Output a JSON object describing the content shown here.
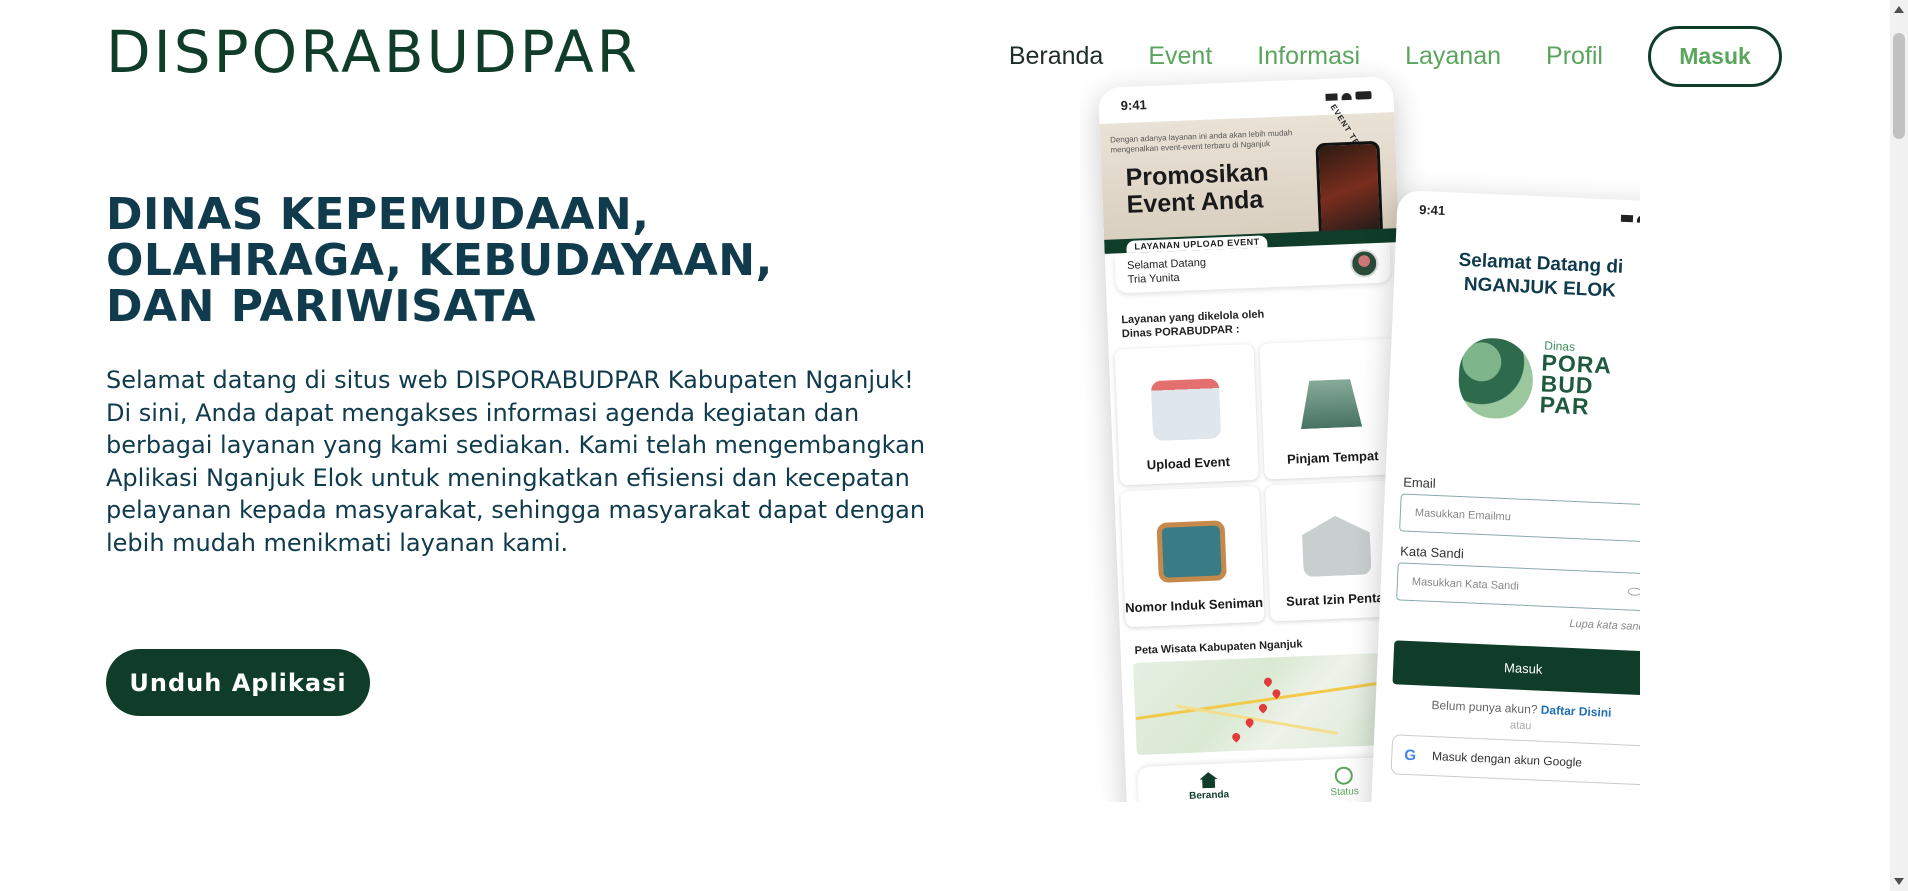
{
  "brand": "DISPORABUDPAR",
  "nav": {
    "items": [
      {
        "label": "Beranda",
        "active": true
      },
      {
        "label": "Event",
        "active": false
      },
      {
        "label": "Informasi",
        "active": false
      },
      {
        "label": "Layanan",
        "active": false
      },
      {
        "label": "Profil",
        "active": false
      }
    ],
    "login_label": "Masuk"
  },
  "hero": {
    "title_lines": [
      "DINAS KEPEMUDAAN,",
      "OLAHRAGA, KEBUDAYAAN,",
      "DAN PARIWISATA"
    ],
    "description": "Selamat datang di situs web DISPORABUDPAR Kabupaten Nganjuk! Di sini, Anda dapat mengakses informasi agenda kegiatan dan berbagai layanan yang kami sediakan. Kami telah mengembangkan Aplikasi Nganjuk Elok untuk meningkatkan efisiensi dan kecepatan pelayanan kepada masyarakat, sehingga masyarakat dapat dengan lebih mudah menikmati layanan kami.",
    "download_label": "Unduh Aplikasi"
  },
  "phone1": {
    "time": "9:41",
    "promo_small": "Dengan adanya layanan ini anda akan lebih mudah mengenalkan event-event terbaru di Nganjuk",
    "promo_title_1": "Promosikan",
    "promo_title_2": "Event Anda",
    "promo_badge": "EVENT TERKINI",
    "promo_label": "LAYANAN UPLOAD EVENT",
    "welcome": "Selamat Datang",
    "user": "Tria Yunita",
    "service_head_1": "Layanan yang dikelola oleh",
    "service_head_2": "Dinas PORABUDPAR :",
    "services": [
      {
        "label": "Upload Event",
        "icon": "calendar-icon"
      },
      {
        "label": "Pinjam Tempat",
        "icon": "building-icon"
      },
      {
        "label": "Nomor Induk Seniman",
        "icon": "artist-icon"
      },
      {
        "label": "Surat Izin Pentas",
        "icon": "mail-icon"
      }
    ],
    "map_head": "Peta Wisata Kabupaten Nganjuk",
    "tab_home": "Beranda",
    "tab_status": "Status"
  },
  "phone2": {
    "time": "9:41",
    "title_1": "Selamat Datang di",
    "title_2": "NGANJUK ELOK",
    "logo_small": "Dinas",
    "logo_line1": "PORA",
    "logo_line2": "BUD",
    "logo_line3": "PAR",
    "email_label": "Email",
    "email_placeholder": "Masukkan Emailmu",
    "password_label": "Kata Sandi",
    "password_placeholder": "Masukkan Kata Sandi",
    "forgot": "Lupa kata sandi?",
    "login_button": "Masuk",
    "signup_text": "Belum punya akun?",
    "signup_link": "Daftar Disini",
    "or": "atau",
    "google": "Masuk dengan akun Google"
  },
  "colors": {
    "primary": "#0f3d2a",
    "accent": "#5aa55c",
    "text": "#0f3b4c"
  }
}
